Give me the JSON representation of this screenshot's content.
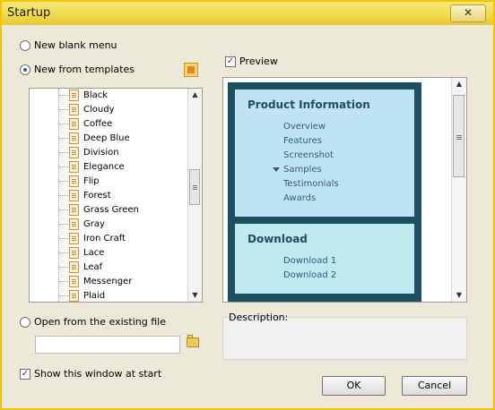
{
  "window": {
    "title": "Startup",
    "close_label": "✕"
  },
  "options": {
    "new_blank_menu": "New blank menu",
    "new_from_templates": "New from templates",
    "open_existing_file": "Open from the existing file",
    "show_at_start": "Show this window at start"
  },
  "templates": [
    "Black",
    "Cloudy",
    "Coffee",
    "Deep Blue",
    "Division",
    "Elegance",
    "Flip",
    "Forest",
    "Grass Green",
    "Gray",
    "Iron Craft",
    "Lace",
    "Leaf",
    "Messenger",
    "Plaid"
  ],
  "preview": {
    "label": "Preview",
    "panel1_title": "Product Information",
    "panel1_items": [
      "Overview",
      "Features",
      "Screenshot",
      "Samples",
      "Testimonials",
      "Awards"
    ],
    "panel2_title": "Download",
    "panel2_items": [
      "Download 1",
      "Download 2"
    ]
  },
  "description": {
    "label": "Description:"
  },
  "buttons": {
    "ok": "OK",
    "cancel": "Cancel"
  }
}
